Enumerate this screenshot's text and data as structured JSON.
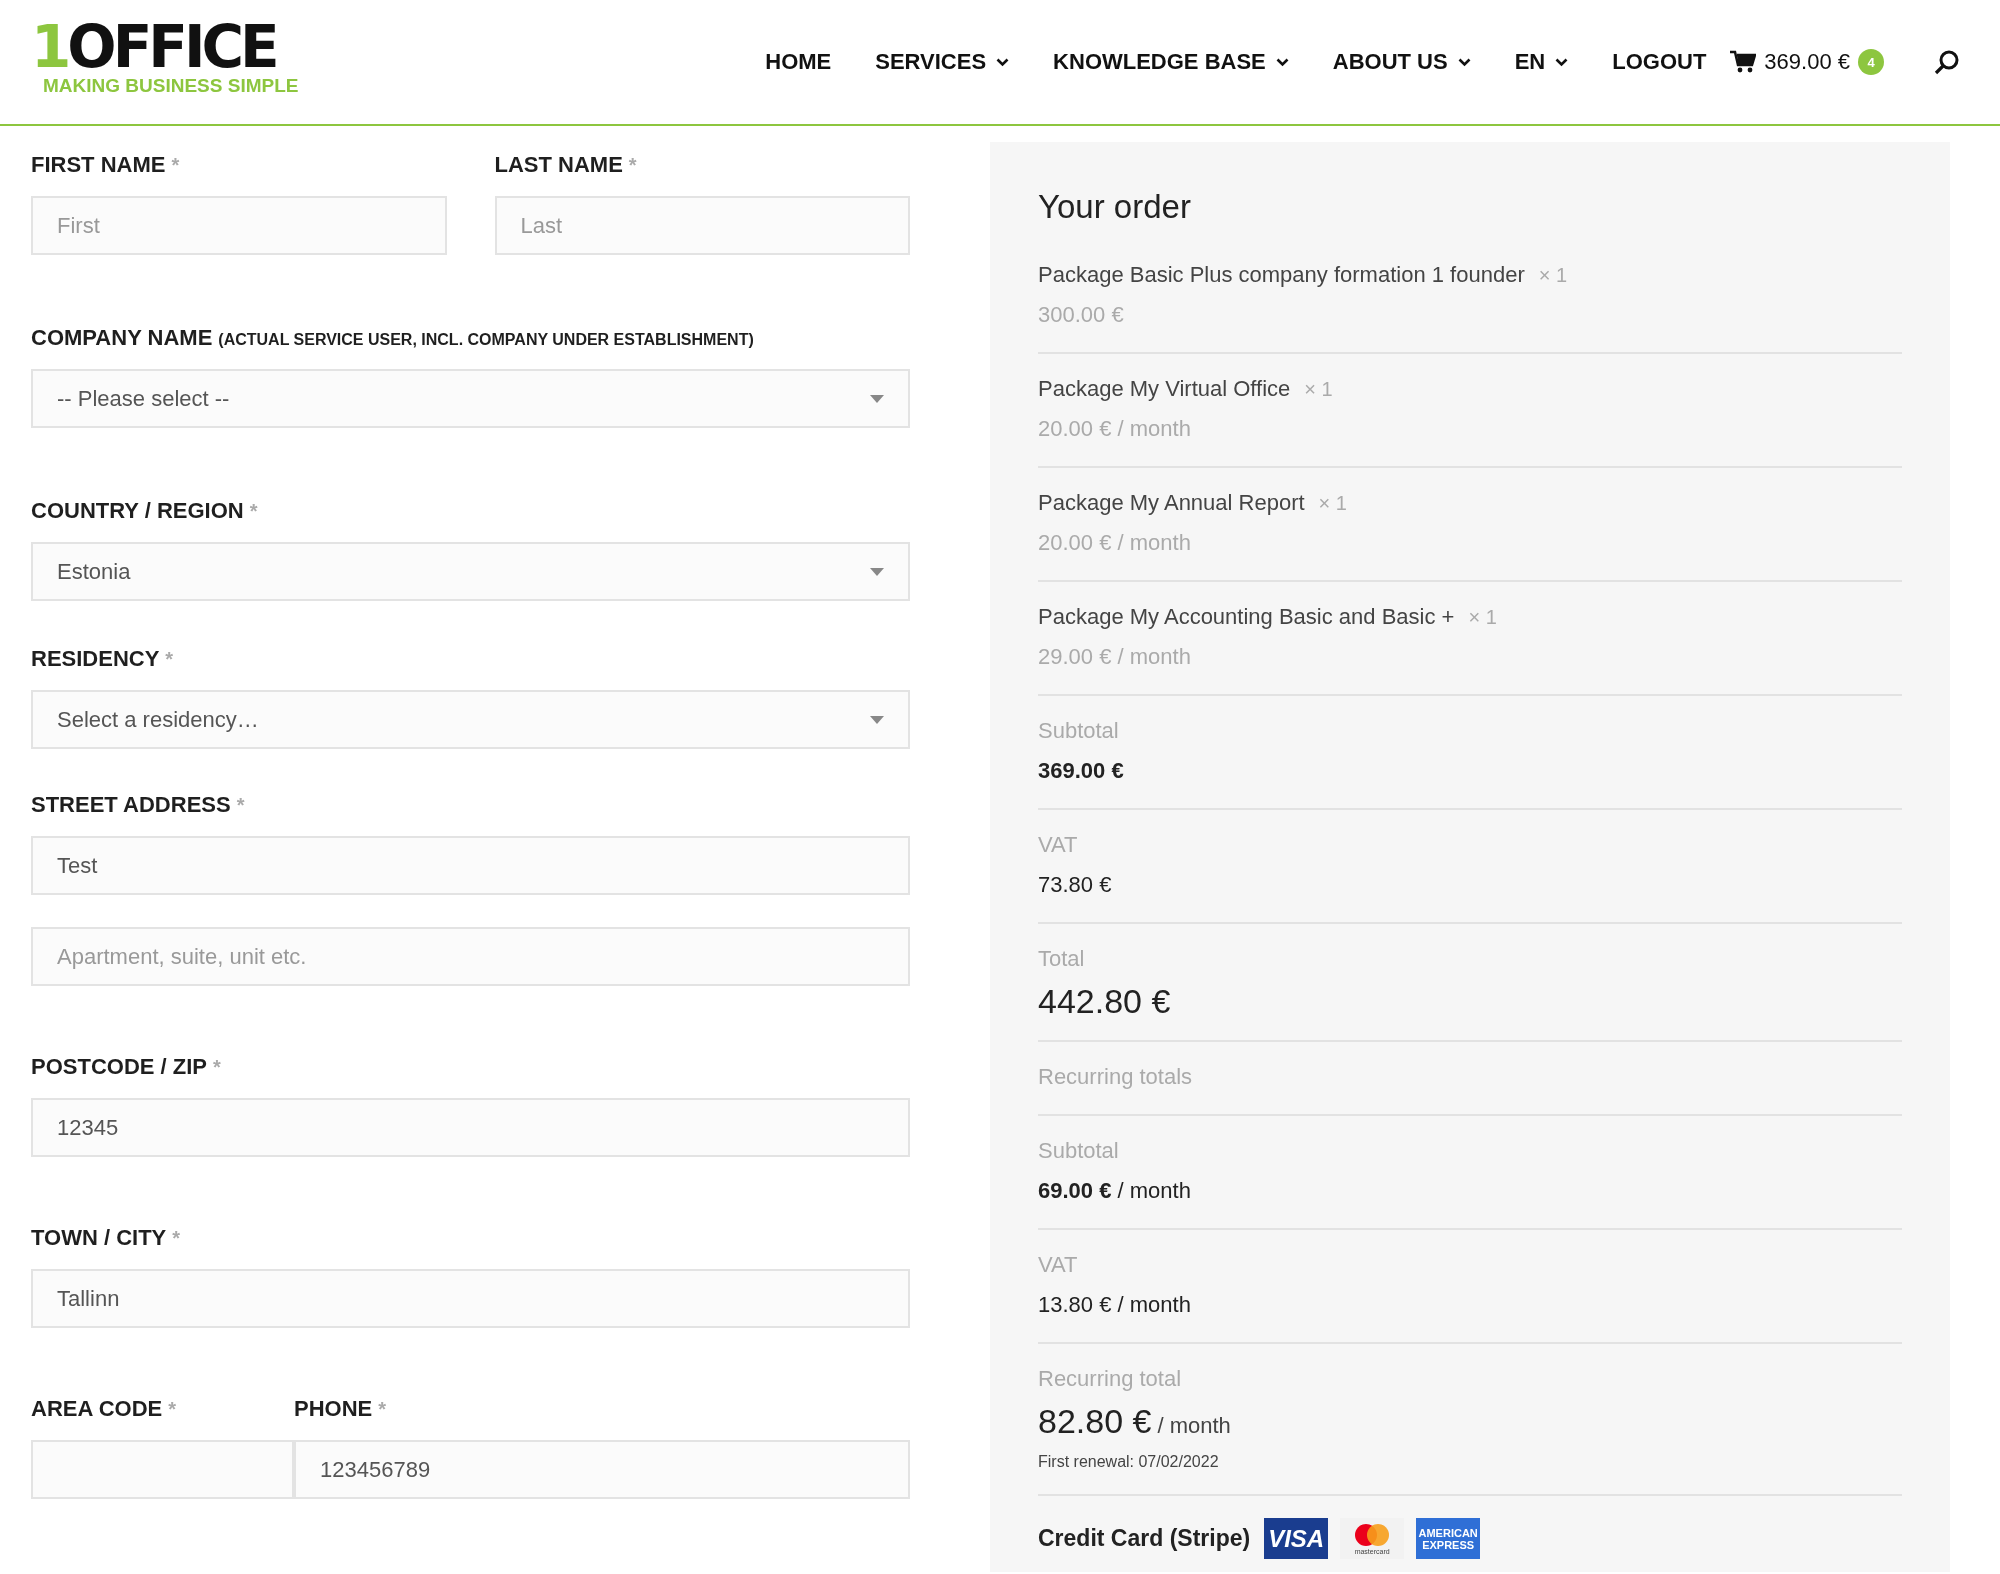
{
  "header": {
    "logo": {
      "mark": "1",
      "name": "OFFICE",
      "tagline": "MAKING BUSINESS SIMPLE"
    },
    "nav": [
      {
        "label": "HOME",
        "has_menu": false
      },
      {
        "label": "SERVICES",
        "has_menu": true
      },
      {
        "label": "KNOWLEDGE BASE",
        "has_menu": true
      },
      {
        "label": "ABOUT US",
        "has_menu": true
      },
      {
        "label": "EN",
        "has_menu": true
      },
      {
        "label": "LOGOUT",
        "has_menu": false
      }
    ],
    "cart": {
      "total": "369.00 €",
      "count": "4"
    }
  },
  "form": {
    "rows": [
      [
        {
          "kind": "text",
          "label": "FIRST NAME",
          "mark": "*",
          "placeholder": "First"
        },
        {
          "kind": "text",
          "label": "LAST NAME",
          "mark": "*",
          "placeholder": "Last"
        }
      ],
      [
        {
          "kind": "select",
          "label": "COMPANY NAME",
          "note": "(ACTUAL SERVICE USER, INCL. COMPANY UNDER ESTABLISHMENT)",
          "value": "-- Please select --"
        }
      ],
      [
        {
          "kind": "select",
          "label": "COUNTRY / REGION",
          "mark": "*",
          "value": "Estonia"
        }
      ],
      [
        {
          "kind": "select",
          "label": "RESIDENCY",
          "mark": "*",
          "value": "Select a residency…"
        }
      ],
      [
        {
          "kind": "text",
          "label": "STREET ADDRESS",
          "mark": "*",
          "value": "Test"
        }
      ],
      [
        {
          "kind": "text",
          "placeholder": "Apartment, suite, unit etc."
        }
      ],
      [
        {
          "kind": "text",
          "label": "POSTCODE / ZIP",
          "mark": "*",
          "value": "12345"
        }
      ],
      [
        {
          "kind": "text",
          "label": "TOWN / CITY",
          "mark": "*",
          "value": "Tallinn"
        }
      ],
      [
        {
          "kind": "text",
          "label": "AREA CODE",
          "mark": "*"
        },
        {
          "kind": "text",
          "label": "PHONE",
          "mark": "*",
          "value": "123456789"
        }
      ]
    ]
  },
  "order": {
    "title": "Your order",
    "items": [
      {
        "name": "Package Basic Plus company formation 1 founder",
        "qty": "× 1",
        "price": "300.00 €"
      },
      {
        "name": "Package My Virtual Office",
        "qty": "× 1",
        "price": "20.00 € / month"
      },
      {
        "name": "Package My Annual Report",
        "qty": "× 1",
        "price": "20.00 € / month"
      },
      {
        "name": "Package My Accounting Basic and Basic +",
        "qty": "× 1",
        "price": "29.00 € / month"
      }
    ],
    "totals": [
      {
        "kind": "bold",
        "label": "Subtotal",
        "value": "369.00 €"
      },
      {
        "kind": "plain",
        "label": "VAT",
        "value": "73.80 €"
      },
      {
        "kind": "large",
        "label": "Total",
        "value": "442.80 €"
      },
      {
        "kind": "heading",
        "label": "Recurring totals"
      },
      {
        "kind": "rich",
        "label": "Subtotal",
        "value": "**69.00 €** / month"
      },
      {
        "kind": "plain",
        "label": "VAT",
        "value": "13.80 € / month"
      },
      {
        "kind": "large",
        "label": "Recurring total",
        "value": "82.80 €",
        "suffix": "/ month",
        "note": "First renewal: 07/02/2022"
      }
    ],
    "payment": {
      "label": "Credit Card (Stripe)",
      "cards": [
        {
          "kind": "visa",
          "text": "VISA"
        },
        {
          "kind": "mastercard",
          "text": "mastercard"
        },
        {
          "kind": "amex",
          "text": "AMERICAN EXPRESS"
        }
      ]
    }
  }
}
